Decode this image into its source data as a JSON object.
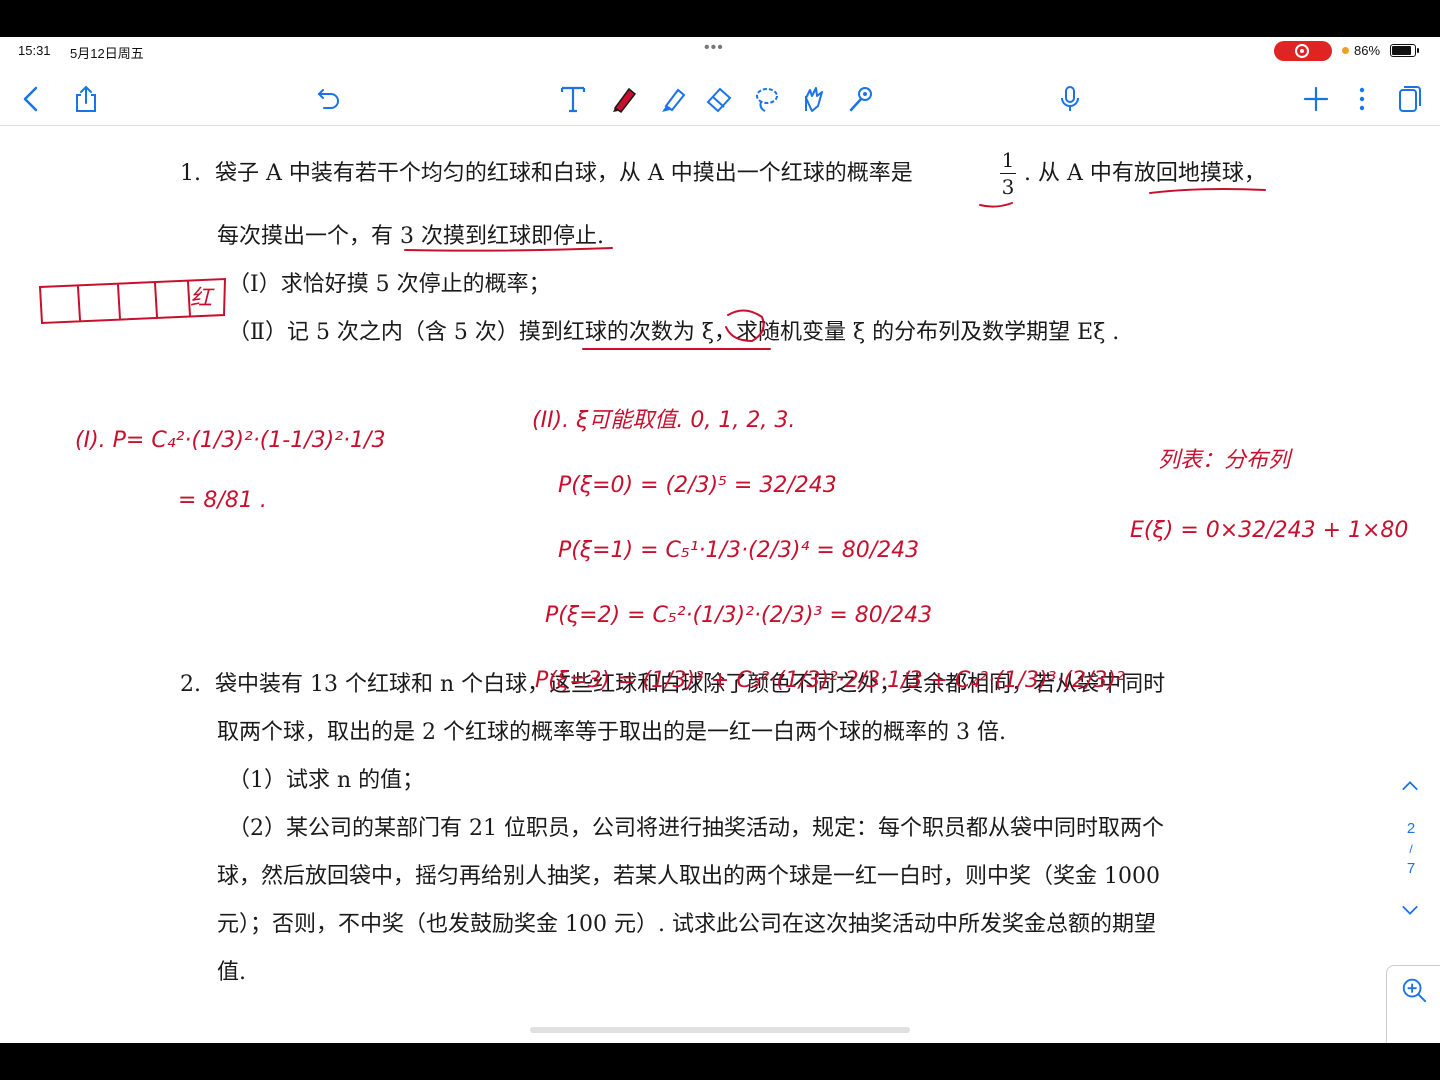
{
  "status": {
    "time": "15:31",
    "date": "5月12日周五",
    "battery": "86%"
  },
  "doc": {
    "p1": {
      "num": "1.",
      "line1a": "袋子 A 中装有若干个均匀的红球和白球，从 A 中摸出一个红球的概率是",
      "frac_num": "1",
      "frac_den": "3",
      "line1b": ". 从 A 中有放回地摸球，",
      "line2": "每次摸出一个，有 3 次摸到红球即停止.",
      "part1": "（Ⅰ）求恰好摸 5 次停止的概率；",
      "part2": "（Ⅱ）记 5 次之内（含 5 次）摸到红球的次数为 ξ，求随机变量 ξ 的分布列及数学期望 Eξ ."
    },
    "p2": {
      "num": "2.",
      "line1": "袋中装有  13  个红球和 n 个白球，这些红球和白球除了颜色不同之外，其余都相同，若从袋中同时",
      "line2": "取两个球，取出的是 2 个红球的概率等于取出的是一红一白两个球的概率的 3 倍.",
      "part1": "（1）试求 n 的值；",
      "part2_l1": "（2）某公司的某部门有  21  位职员，公司将进行抽奖活动，规定：每个职员都从袋中同时取两个",
      "part2_l2": "球，然后放回袋中，摇匀再给别人抽奖，若某人取出的两个球是一红一白时，则中奖（奖金  1000",
      "part2_l3": "元）；否则，不中奖（也发鼓励奖金  100  元）. 试求此公司在这次抽奖活动中所发奖金总额的期望",
      "part2_l4": "值."
    }
  },
  "ink": {
    "red_label": "红",
    "part1_formula": "(I). P= C₄²·(1/3)²·(1-1/3)²·1/3",
    "part1_result": "= 8/81 .",
    "part2_values": "(II). ξ可能取值. 0, 1, 2, 3.",
    "p0": "P(ξ=0) = (2/3)⁵ = 32/243",
    "p1": "P(ξ=1) = C₅¹·1/3·(2/3)⁴ = 80/243",
    "p2": "P(ξ=2) = C₅²·(1/3)²·(2/3)³ = 80/243",
    "p3": "P(ξ=3) = (1/3)³ + C₃²·(1/3)²·2/3·1/3 + C₄²·(1/3)³·(2/3)²",
    "table_note": "列表：分布列",
    "expectation": "E(ξ) = 0×32/243 + 1×80"
  },
  "page": {
    "current": "2",
    "total": "7"
  }
}
